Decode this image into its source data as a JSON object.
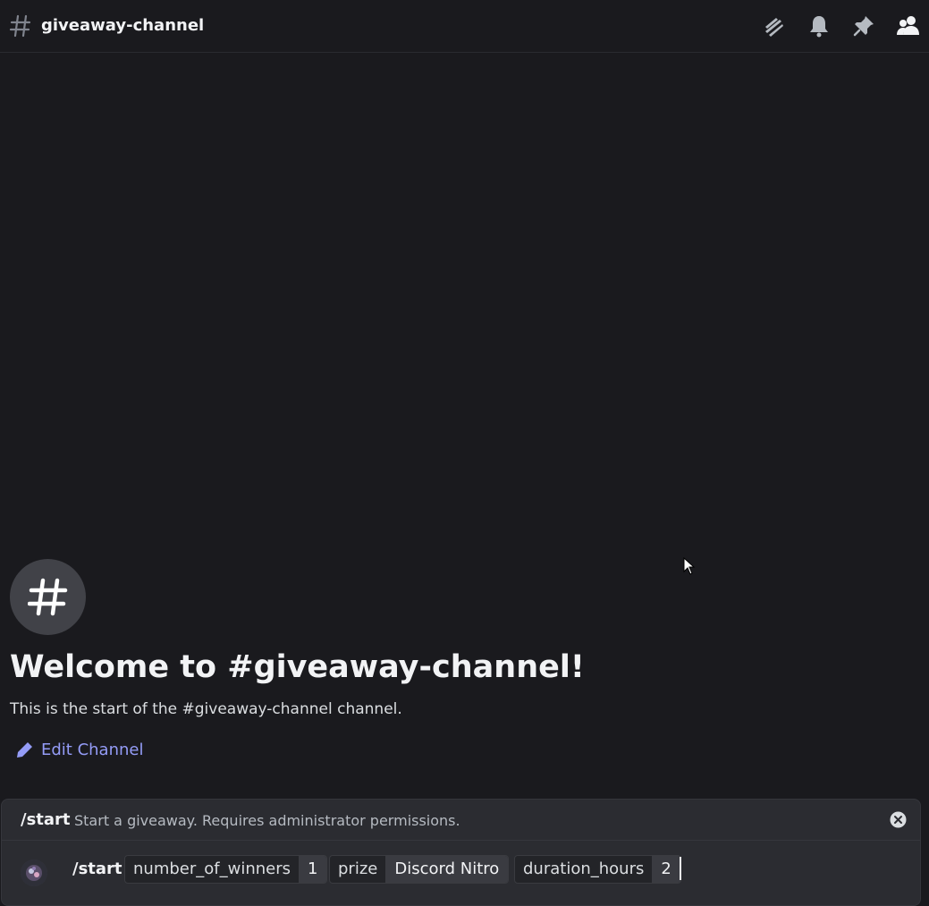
{
  "header": {
    "channel_name": "giveaway-channel",
    "icons": [
      "threads-icon",
      "bell-icon",
      "pin-icon",
      "members-icon"
    ]
  },
  "welcome": {
    "title": "Welcome to #giveaway-channel!",
    "subtitle": "This is the start of the #giveaway-channel channel.",
    "edit_label": "Edit Channel"
  },
  "command": {
    "name": "/start",
    "description": "Start a giveaway. Requires administrator permissions.",
    "input_name": "/start",
    "options": [
      {
        "name": "number_of_winners",
        "value": "1"
      },
      {
        "name": "prize",
        "value": "Discord Nitro"
      },
      {
        "name": "duration_hours",
        "value": "2"
      }
    ]
  },
  "colors": {
    "background": "#1a1a1e",
    "accent_link": "#949cf7",
    "command_box": "#2b2c31"
  }
}
